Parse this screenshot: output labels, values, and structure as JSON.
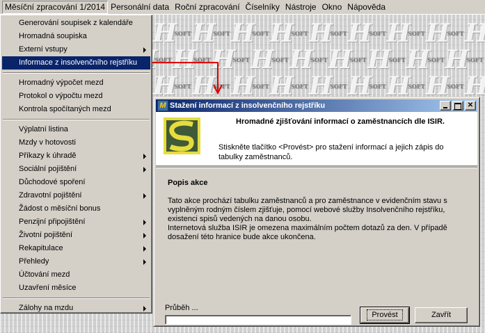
{
  "menubar": {
    "items": [
      {
        "label": "Měsíční zpracování 1/2014",
        "open": true
      },
      {
        "label": "Personální data"
      },
      {
        "label": "Roční zpracování"
      },
      {
        "label": "Číselníky"
      },
      {
        "label": "Nástroje"
      },
      {
        "label": "Okno"
      },
      {
        "label": "Nápověda"
      }
    ]
  },
  "dropdown": {
    "group1": [
      {
        "label": "Generování soupisek z kalendáře"
      },
      {
        "label": "Hromadná soupiska"
      },
      {
        "label": "Externí vstupy",
        "submenu": true
      },
      {
        "label": "Informace z insolvenčního rejstříku",
        "highlighted": true
      }
    ],
    "group2": [
      {
        "label": "Hromadný výpočet mezd"
      },
      {
        "label": "Protokol o výpočtu mezd"
      },
      {
        "label": "Kontrola spočítaných mezd"
      }
    ],
    "group3": [
      {
        "label": "Výplatní listina"
      },
      {
        "label": "Mzdy v hotovosti"
      },
      {
        "label": "Příkazy k úhradě",
        "submenu": true
      },
      {
        "label": "Sociální pojištění",
        "submenu": true
      },
      {
        "label": "Důchodové spoření"
      },
      {
        "label": "Zdravotní pojištění",
        "submenu": true
      },
      {
        "label": "Žádost o měsíční bonus"
      },
      {
        "label": "Penzijní připojištění",
        "submenu": true
      },
      {
        "label": "Životní pojištění",
        "submenu": true
      },
      {
        "label": "Rekapitulace",
        "submenu": true
      },
      {
        "label": "Přehledy",
        "submenu": true
      },
      {
        "label": "Účtování mezd"
      },
      {
        "label": "Uzavření měsíce"
      }
    ],
    "group4": [
      {
        "label": "Zálohy na mzdu",
        "submenu": true
      }
    ]
  },
  "dialog": {
    "title": "Stažení informací z insolvenčního rejstříku",
    "header_title": "Hromadné zjišťování informací o zaměstnancích dle ISIR.",
    "header_desc": "Stiskněte tlačítko <Provést> pro stažení informací a jejich zápis do tabulky zaměstnanců.",
    "popis_title": "Popis akce",
    "popis_p1": "Tato akce prochází tabulku zaměstnanců a pro zaměstnance v evidenčním stavu s vyplněným rodným číslem zjišťuje, pomocí webové služby Insolvenčního rejstříku, existenci spisů vedených na danou osobu.",
    "popis_p2": "Internetová služba ISIR je omezena maximálním počtem dotazů za den. V případě dosažení této hranice bude akce ukončena.",
    "progress_label": "Průběh ...",
    "progress": 0,
    "buttons": {
      "execute": "Provést",
      "cancel": "Zavřít"
    }
  },
  "colors": {
    "highlight": "#0a246a",
    "annotation_arrow": "#e00000",
    "logo_green": "#3f5a38",
    "logo_yellow": "#e6dc3c"
  }
}
